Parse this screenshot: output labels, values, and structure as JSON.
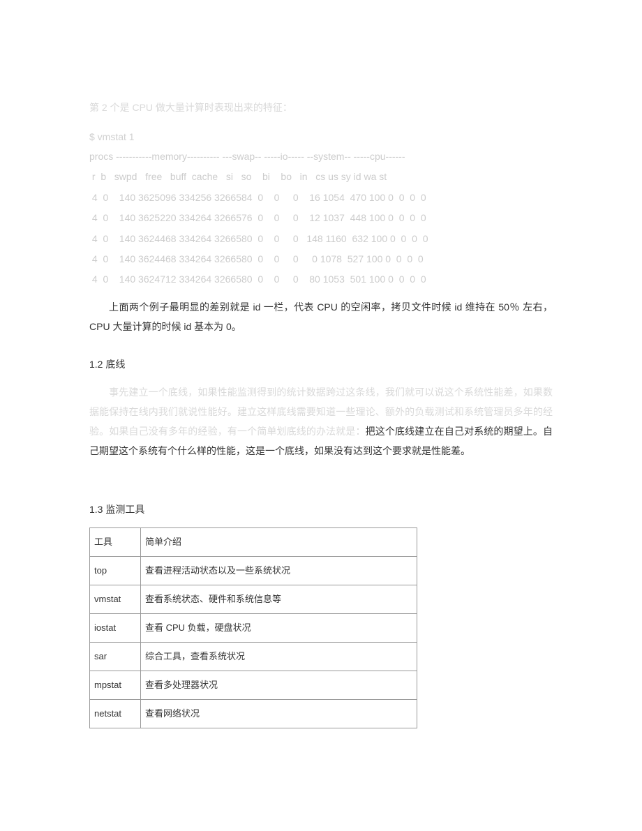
{
  "intro_line": "第 2 个是 CPU 做大量计算时表现出来的特征：",
  "cmd": "$ vmstat 1",
  "header1": "procs -----------memory---------- ---swap-- -----io----- --system-- -----cpu------",
  "header2": " r  b   swpd   free   buff  cache   si   so    bi    bo   in   cs us sy id wa st",
  "rows": [
    " 4  0    140 3625096 334256 3266584  0    0     0    16 1054  470 100 0  0  0  0",
    " 4  0    140 3625220 334264 3266576  0    0     0    12 1037  448 100 0  0  0  0",
    " 4  0    140 3624468 334264 3266580  0    0     0   148 1160  632 100 0  0  0  0",
    " 4  0    140 3624468 334264 3266580  0    0     0     0 1078  527 100 0  0  0  0",
    " 4  0    140 3624712 334264 3266580  0    0     0    80 1053  501 100 0  0  0  0"
  ],
  "para1": "上面两个例子最明显的差别就是 id 一栏，代表 CPU 的空闲率，拷贝文件时候 id 维持在 50％ 左右，CPU 大量计算的时候 id 基本为 0。",
  "sec12": "1.2  底线",
  "para2a": "事先建立一个底线，如果性能监测得到的统计数据跨过这条线，我们就可以说这个系统性能差，如果数据能保持在线内我们就说性能好。建立这样底线需要知道一些理论、额外的负载测试和系统管理员多年的经验。如果自己没有多年的经验，有一个简单划底线的办法就是：",
  "para2b": "把这个底线建立在自己对系统的期望上。自己期望这个系统有个什么样的性能，这是一个底线，如果没有达到这个要求就是性能差。",
  "sec13": "1.3  监测工具",
  "th1": "工具",
  "th2": "简单介绍",
  "tools": [
    {
      "name": "top",
      "desc": "查看进程活动状态以及一些系统状况"
    },
    {
      "name": "vmstat",
      "desc": "查看系统状态、硬件和系统信息等"
    },
    {
      "name": "iostat",
      "desc": "查看 CPU 负载，硬盘状况"
    },
    {
      "name": "sar",
      "desc": "综合工具，查看系统状况"
    },
    {
      "name": "mpstat",
      "desc": "查看多处理器状况"
    },
    {
      "name": "netstat",
      "desc": "查看网络状况"
    }
  ]
}
